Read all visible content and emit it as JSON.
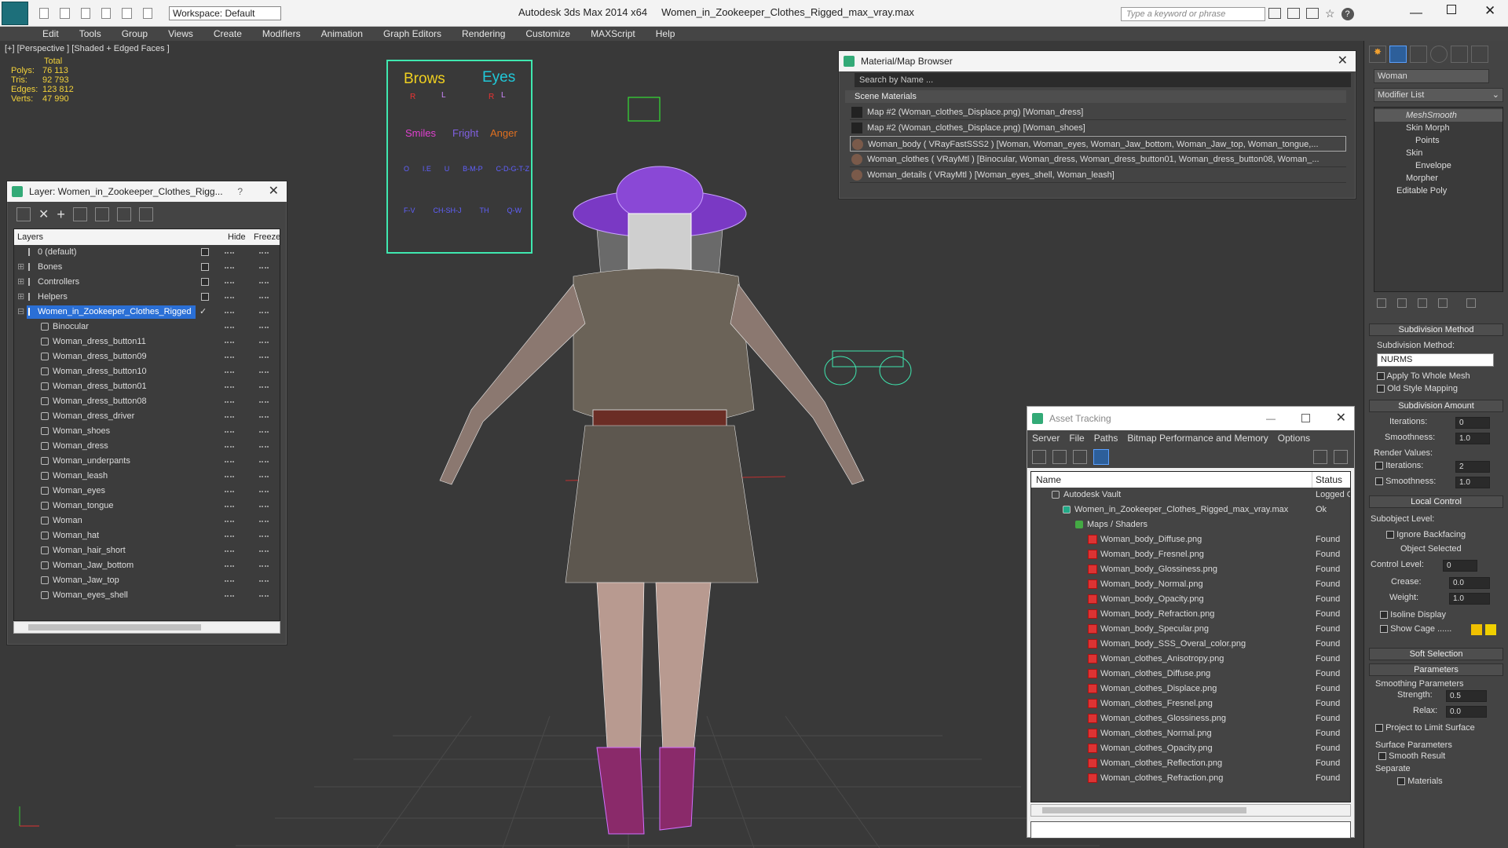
{
  "app": {
    "title": "Autodesk 3ds Max  2014 x64",
    "file": "Women_in_Zookeeper_Clothes_Rigged_max_vray.max",
    "workspace": "Workspace: Default",
    "search_placeholder": "Type a keyword or phrase"
  },
  "menu": [
    "Edit",
    "Tools",
    "Group",
    "Views",
    "Create",
    "Modifiers",
    "Animation",
    "Graph Editors",
    "Rendering",
    "Customize",
    "MAXScript",
    "Help"
  ],
  "viewport": {
    "label": "[+] [Perspective ] [Shaded + Edged Faces ]",
    "stats": {
      "header": "Total",
      "rows": [
        {
          "k": "Polys:",
          "v": "76 113"
        },
        {
          "k": "Tris:",
          "v": "92 793"
        },
        {
          "k": "Edges:",
          "v": "123 812"
        },
        {
          "k": "Verts:",
          "v": "47 990"
        }
      ]
    }
  },
  "face_ui": {
    "brows": "Brows",
    "eyes": "Eyes",
    "R": "R",
    "L": "L",
    "smiles": "Smiles",
    "fright": "Fright",
    "anger": "Anger",
    "row2": [
      "O",
      "I.E",
      "U",
      "B-M-P",
      "C-D-G-T-Z"
    ],
    "row3": [
      "F-V",
      "CH-SH-J",
      "TH",
      "Q-W"
    ]
  },
  "layers": {
    "title": "Layer: Women_in_Zookeeper_Clothes_Rigg...",
    "help": "?",
    "col_layers": "Layers",
    "col_hide": "Hide",
    "col_freeze": "Freeze",
    "top": [
      "0 (default)",
      "Bones",
      "Controllers",
      "Helpers"
    ],
    "selected": "Women_in_Zookeeper_Clothes_Rigged",
    "children": [
      "Binocular",
      "Woman_dress_button11",
      "Woman_dress_button09",
      "Woman_dress_button10",
      "Woman_dress_button01",
      "Woman_dress_button08",
      "Woman_dress_driver",
      "Woman_shoes",
      "Woman_dress",
      "Woman_underpants",
      "Woman_leash",
      "Woman_eyes",
      "Woman_tongue",
      "Woman",
      "Woman_hat",
      "Woman_hair_short",
      "Woman_Jaw_bottom",
      "Woman_Jaw_top",
      "Woman_eyes_shell"
    ]
  },
  "material_browser": {
    "title": "Material/Map Browser",
    "search": "Search by Name ...",
    "section": "Scene Materials",
    "items": [
      "Map #2 (Woman_clothes_Displace.png) [Woman_dress]",
      "Map #2 (Woman_clothes_Displace.png) [Woman_shoes]",
      "Woman_body  ( VRayFastSSS2 )  [Woman, Woman_eyes, Woman_Jaw_bottom, Woman_Jaw_top, Woman_tongue,...",
      "Woman_clothes  ( VRayMtl )  [Binocular, Woman_dress, Woman_dress_button01, Woman_dress_button08, Woman_...",
      "Woman_details  ( VRayMtl )  [Woman_eyes_shell, Woman_leash]"
    ]
  },
  "asset_tracking": {
    "title": "Asset Tracking",
    "menu": [
      "Server",
      "File",
      "Paths",
      "Bitmap Performance and Memory",
      "Options"
    ],
    "col_name": "Name",
    "col_status": "Status",
    "vault": "Autodesk Vault",
    "vault_status": "Logged Ou",
    "file": "Women_in_Zookeeper_Clothes_Rigged_max_vray.max",
    "file_status": "Ok",
    "maps": "Maps / Shaders",
    "assets": [
      "Woman_body_Diffuse.png",
      "Woman_body_Fresnel.png",
      "Woman_body_Glossiness.png",
      "Woman_body_Normal.png",
      "Woman_body_Opacity.png",
      "Woman_body_Refraction.png",
      "Woman_body_Specular.png",
      "Woman_body_SSS_Overal_color.png",
      "Woman_clothes_Anisotropy.png",
      "Woman_clothes_Diffuse.png",
      "Woman_clothes_Displace.png",
      "Woman_clothes_Fresnel.png",
      "Woman_clothes_Glossiness.png",
      "Woman_clothes_Normal.png",
      "Woman_clothes_Opacity.png",
      "Woman_clothes_Reflection.png",
      "Woman_clothes_Refraction.png"
    ],
    "found": "Found"
  },
  "command_panel": {
    "object_name": "Woman",
    "modifier_list": "Modifier List",
    "stack": [
      "MeshSmooth",
      "Skin Morph",
      "Points",
      "Skin",
      "Envelope",
      "Morpher",
      "Editable Poly"
    ],
    "subdivision_method": "Subdivision Method",
    "sub_method_label": "Subdivision Method:",
    "nurms": "NURMS",
    "apply_whole": "Apply To Whole Mesh",
    "old_style": "Old Style Mapping",
    "subdivision_amount": "Subdivision Amount",
    "iterations": "Iterations:",
    "iter_val": "0",
    "smoothness": "Smoothness:",
    "smooth_val": "1.0",
    "render_values": "Render Values:",
    "r_iter_val": "2",
    "r_smooth_val": "1.0",
    "local_control": "Local Control",
    "subobject_level": "Subobject Level:",
    "ignore_backfacing": "Ignore Backfacing",
    "object_selected": "Object Selected",
    "control_level": "Control Level:",
    "control_val": "0",
    "crease": "Crease:",
    "crease_val": "0.0",
    "weight": "Weight:",
    "weight_val": "1.0",
    "isoline": "Isoline Display",
    "show_cage": "Show Cage ......",
    "soft_selection": "Soft Selection",
    "parameters": "Parameters",
    "smoothing_params": "Smoothing Parameters",
    "strength": "Strength:",
    "strength_val": "0.5",
    "relax": "Relax:",
    "relax_val": "0.0",
    "project": "Project to Limit Surface",
    "surface_params": "Surface Parameters",
    "smooth_result": "Smooth Result",
    "separate": "Separate",
    "materials": "Materials"
  },
  "colors": {
    "accent": "#2a6fd6",
    "stats": "#f2d13a",
    "wire": "#e8e8e8",
    "purple": "#a030e0"
  }
}
